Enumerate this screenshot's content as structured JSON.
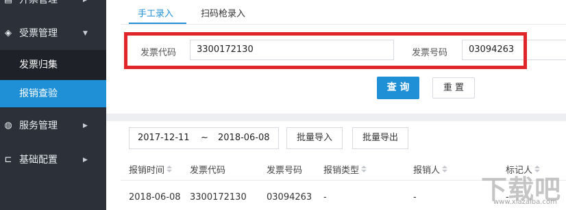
{
  "sidebar": {
    "items": [
      {
        "label": "开票管理",
        "icon": "invoice-icon"
      },
      {
        "label": "受票管理",
        "icon": "layers-icon"
      },
      {
        "label": "服务管理",
        "icon": "globe-icon"
      },
      {
        "label": "基础配置",
        "icon": "config-icon"
      }
    ],
    "sub_items": [
      {
        "label": "发票归集"
      },
      {
        "label": "报销查验",
        "active": true
      }
    ]
  },
  "tabs": [
    "手工录入",
    "扫码枪录入"
  ],
  "form": {
    "code_label": "发票代码",
    "code_value": "3300172130",
    "number_label": "发票号码",
    "number_value": "03094263",
    "query_button": "查 询",
    "reset_button": "重 置"
  },
  "filter": {
    "date_start": "2017-12-11",
    "date_sep": "~",
    "date_end": "2018-06-08",
    "batch_import": "批量导入",
    "batch_export": "批量导出"
  },
  "table": {
    "columns": [
      "报销时间",
      "发票代码",
      "发票号码",
      "报销类型",
      "报销人",
      "标记人"
    ],
    "rows": [
      [
        "2018-06-08",
        "3300172130",
        "03094263",
        "-",
        "-",
        "-"
      ]
    ]
  },
  "watermark": {
    "big": "下载吧",
    "small": "www.xiazaiba.com"
  },
  "colors": {
    "sidebar_bg": "#2b3039",
    "accent": "#2090d6",
    "highlight_frame": "#e0262b"
  }
}
